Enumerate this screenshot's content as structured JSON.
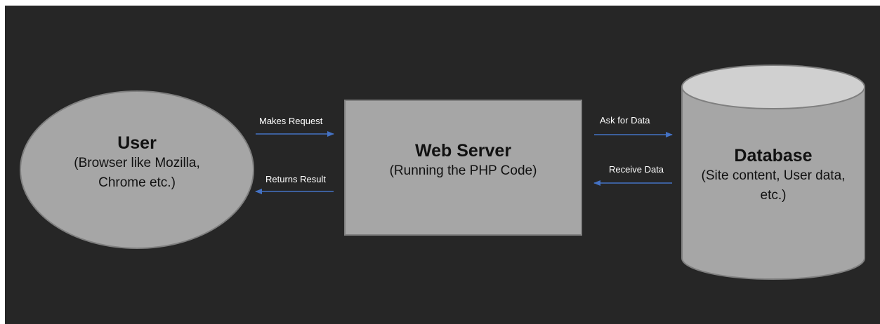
{
  "nodes": {
    "user": {
      "title": "User",
      "subtitle_line1": "(Browser like Mozilla,",
      "subtitle_line2": "Chrome etc.)"
    },
    "web_server": {
      "title": "Web Server",
      "subtitle": "(Running the PHP Code)"
    },
    "database": {
      "title": "Database",
      "subtitle_line1": "(Site content, User data,",
      "subtitle_line2": "etc.)"
    }
  },
  "edges": {
    "makes_request": "Makes Request",
    "returns_result": "Returns Result",
    "ask_for_data": "Ask for Data",
    "receive_data": "Receive Data"
  },
  "colors": {
    "background": "#262626",
    "node_fill": "#a6a6a6",
    "node_stroke": "#7f7f7f",
    "cylinder_top": "#d0d0d0",
    "arrow": "#4472c4",
    "label_text": "#ffffff"
  }
}
